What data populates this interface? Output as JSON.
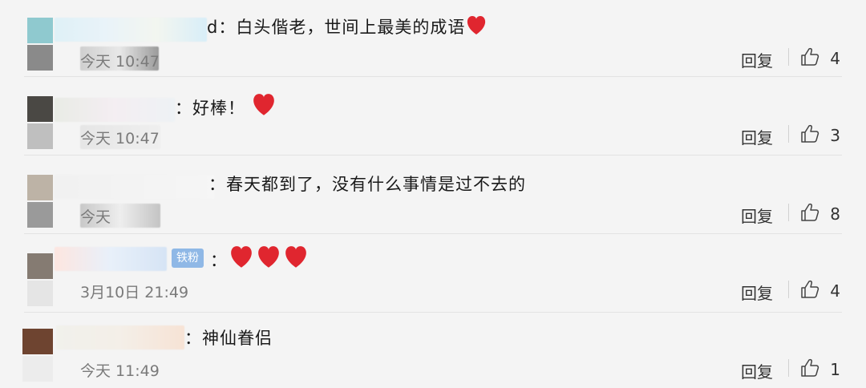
{
  "comments": [
    {
      "user_suffix": "d：",
      "text": "白头偕老，世间上最美的成语",
      "hearts": 1,
      "time": "今天 10:47",
      "reply_label": "回复",
      "likes": "4"
    },
    {
      "user_suffix": "：",
      "text": "好棒！",
      "hearts": 1,
      "time": "今天 10:47",
      "reply_label": "回复",
      "likes": "3"
    },
    {
      "user_suffix": "：",
      "text": "春天都到了，没有什么事情是过不去的",
      "hearts": 0,
      "time": "今天",
      "reply_label": "回复",
      "likes": "8"
    },
    {
      "user_suffix": "：",
      "badge": "铁粉",
      "text": "",
      "hearts": 3,
      "time": "3月10日 21:49",
      "reply_label": "回复",
      "likes": "4"
    },
    {
      "user_suffix": "：",
      "text": "神仙眷侣",
      "hearts": 0,
      "time": "今天 11:49",
      "reply_label": "回复",
      "likes": "1"
    }
  ],
  "colors": {
    "heart": "#e0262f",
    "badge": "#8fb8e6",
    "divider": "#e2e2e2"
  },
  "icons": {
    "like": "thumbs-up-icon",
    "heart": "heart-icon"
  }
}
